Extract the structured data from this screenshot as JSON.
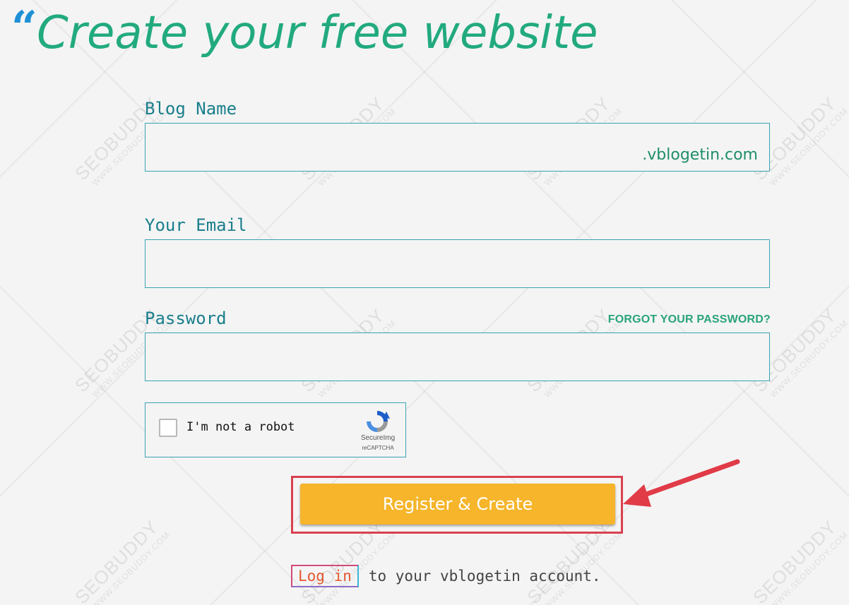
{
  "page": {
    "title": "Create your free website"
  },
  "form": {
    "blog_name_label": "Blog Name",
    "blog_name_value": "",
    "domain_suffix": ".vblogetin.com",
    "email_label": "Your Email",
    "email_value": "",
    "password_label": "Password",
    "password_value": "",
    "forgot_password": "FORGOT YOUR PASSWORD?",
    "captcha_label": "I'm not a robot",
    "captcha_brand": "SecureImg",
    "captcha_sub": "reCAPTCHA",
    "captcha_checked": false,
    "submit_label": "Register & Create",
    "login_link": "Log in",
    "login_suffix": "to your vblogetin account."
  },
  "watermark": {
    "brand": "SEOBUDDY",
    "url": "WWW.SEOBUDDY.COM"
  },
  "colors": {
    "title": "#22aa7f",
    "label": "#1a7e8c",
    "border": "#3aa3b3",
    "button": "#f6b52b",
    "annotation": "#d94150",
    "quote": "#1e90d6"
  },
  "icons": {
    "captcha_logo": "recaptcha-icon",
    "annotation_arrow": "arrow-icon",
    "quote": "quote-icon"
  }
}
